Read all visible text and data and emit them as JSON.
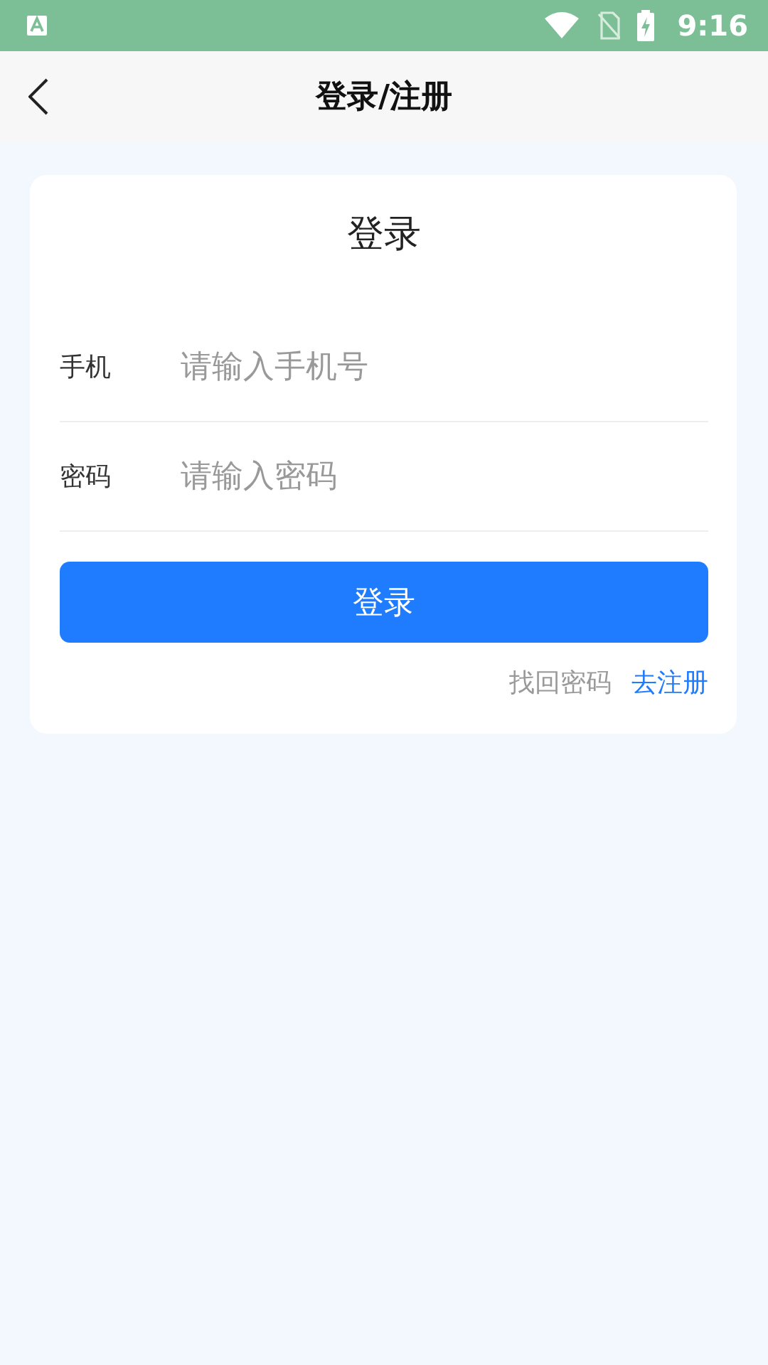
{
  "status_bar": {
    "time": "9:16"
  },
  "header": {
    "title": "登录/注册"
  },
  "card": {
    "title": "登录",
    "fields": [
      {
        "label": "手机",
        "placeholder": "请输入手机号"
      },
      {
        "label": "密码",
        "placeholder": "请输入密码"
      }
    ],
    "submit": "登录",
    "links": [
      {
        "label": "找回密码",
        "kind": "muted"
      },
      {
        "label": "去注册",
        "kind": "primary"
      }
    ]
  }
}
